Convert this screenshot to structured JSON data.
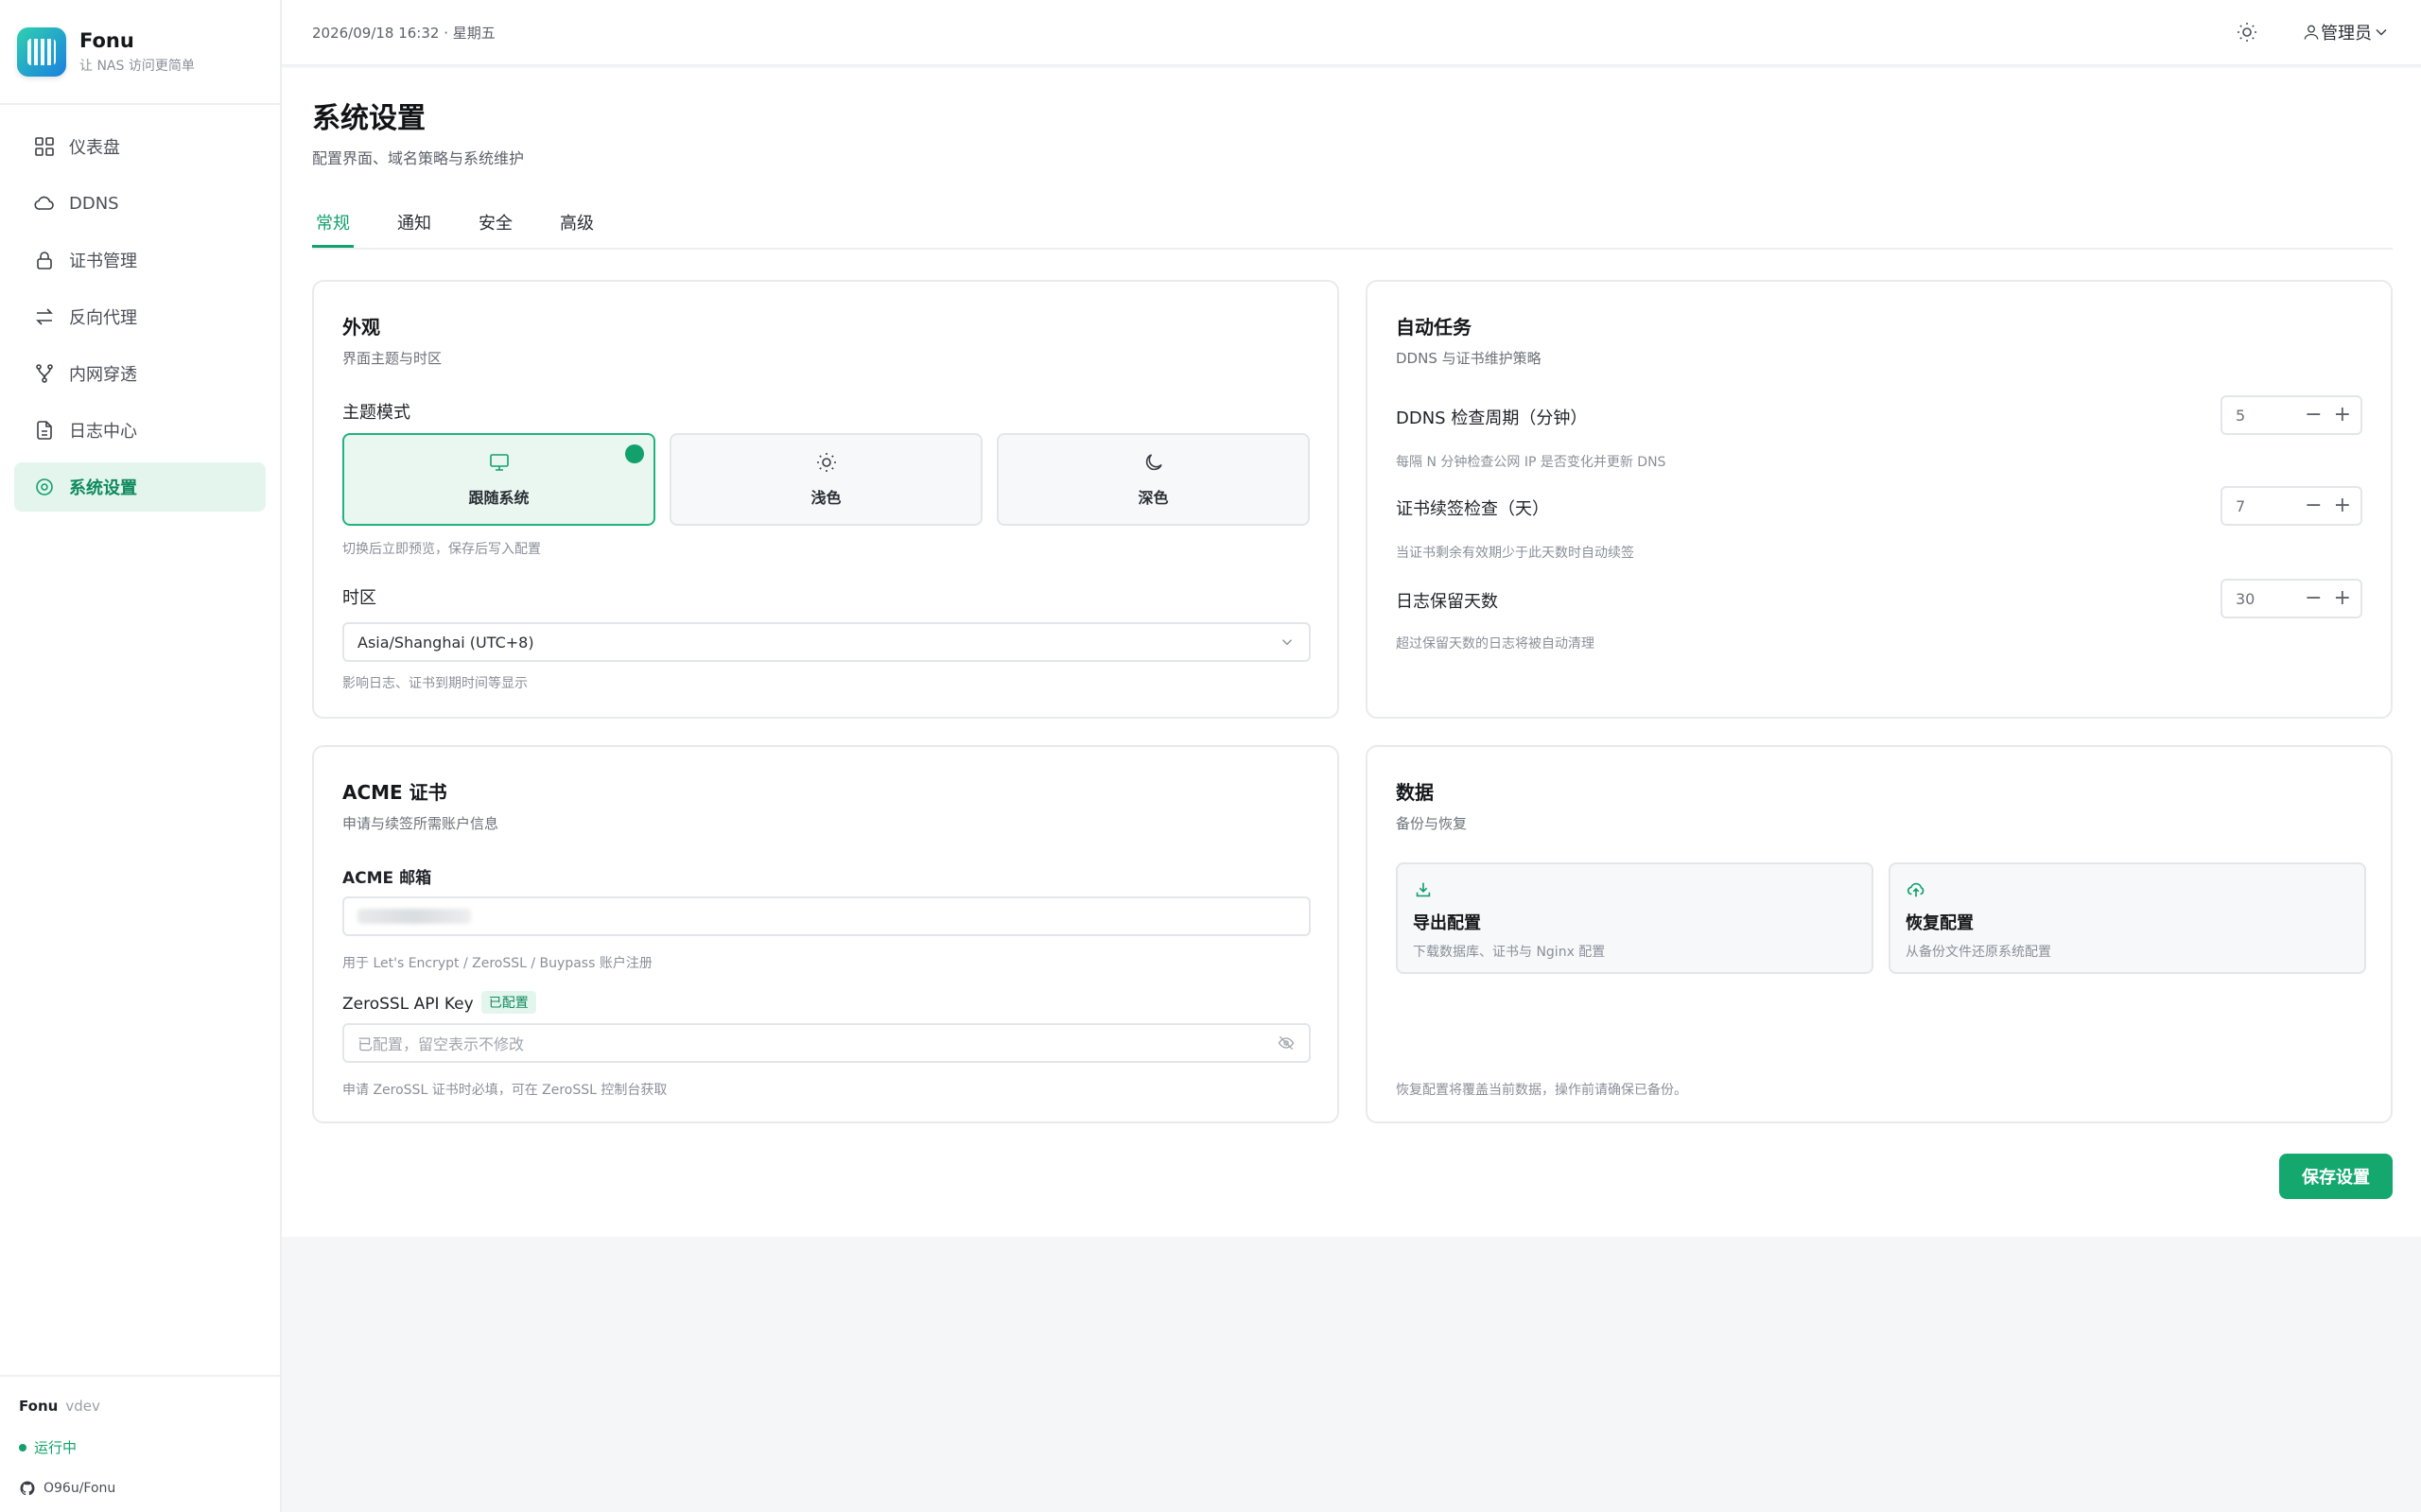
{
  "brand": {
    "name": "Fonu",
    "tagline": "让 NAS 访问更简单"
  },
  "nav": [
    {
      "label": "仪表盘",
      "icon": "grid-icon"
    },
    {
      "label": "DDNS",
      "icon": "cloud-icon"
    },
    {
      "label": "证书管理",
      "icon": "lock-icon"
    },
    {
      "label": "反向代理",
      "icon": "swap-icon"
    },
    {
      "label": "内网穿透",
      "icon": "branch-icon"
    },
    {
      "label": "日志中心",
      "icon": "file-icon"
    },
    {
      "label": "系统设置",
      "icon": "gear-icon",
      "active": true
    }
  ],
  "footer": {
    "app": "Fonu",
    "version": "vdev",
    "status": "运行中",
    "repo": "O96u/Fonu"
  },
  "topbar": {
    "datetime": "2026/09/18 16:32 · 星期五",
    "user": "管理员"
  },
  "page": {
    "title": "系统设置",
    "subtitle": "配置界面、域名策略与系统维护"
  },
  "tabs": [
    "常规",
    "通知",
    "安全",
    "高级"
  ],
  "appearance": {
    "title": "外观",
    "subtitle": "界面主题与时区",
    "theme_label": "主题模式",
    "themes": [
      "跟随系统",
      "浅色",
      "深色"
    ],
    "theme_help": "切换后立即预览，保存后写入配置",
    "tz_label": "时区",
    "tz_value": "Asia/Shanghai (UTC+8)",
    "tz_help": "影响日志、证书到期时间等显示"
  },
  "tasks": {
    "title": "自动任务",
    "subtitle": "DDNS 与证书维护策略",
    "items": [
      {
        "label": "DDNS 检查周期（分钟）",
        "value": "5",
        "help": "每隔 N 分钟检查公网 IP 是否变化并更新 DNS"
      },
      {
        "label": "证书续签检查（天）",
        "value": "7",
        "help": "当证书剩余有效期少于此天数时自动续签"
      },
      {
        "label": "日志保留天数",
        "value": "30",
        "help": "超过保留天数的日志将被自动清理"
      }
    ]
  },
  "acme": {
    "title": "ACME 证书",
    "subtitle": "申请与续签所需账户信息",
    "email_label": "ACME 邮箱",
    "email_help": "用于 Let's Encrypt / ZeroSSL / Buypass 账户注册",
    "key_label": "ZeroSSL API Key",
    "key_badge": "已配置",
    "key_placeholder": "已配置，留空表示不修改",
    "key_help": "申请 ZeroSSL 证书时必填，可在 ZeroSSL 控制台获取"
  },
  "data": {
    "title": "数据",
    "subtitle": "备份与恢复",
    "export_title": "导出配置",
    "export_desc": "下载数据库、证书与 Nginx 配置",
    "restore_title": "恢复配置",
    "restore_desc": "从备份文件还原系统配置",
    "note": "恢复配置将覆盖当前数据，操作前请确保已备份。"
  },
  "save_label": "保存设置"
}
